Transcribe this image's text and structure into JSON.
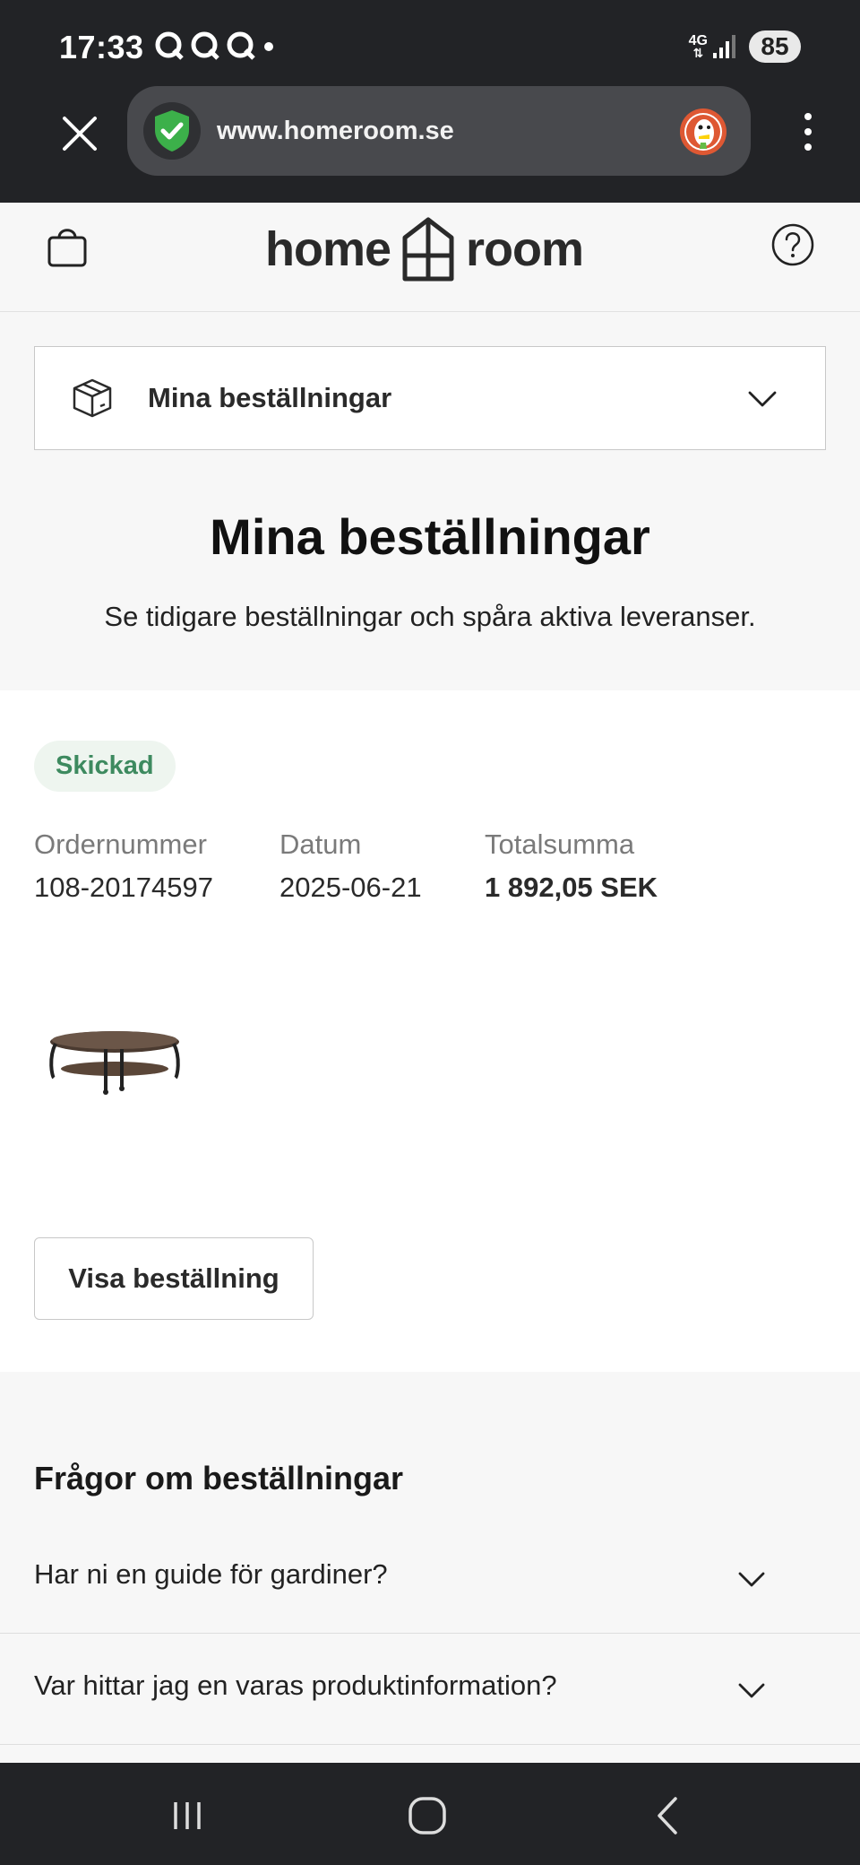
{
  "status_bar": {
    "time": "17:33",
    "network": "4G",
    "battery": "85"
  },
  "browser": {
    "url": "www.homeroom.se"
  },
  "header": {
    "logo_left": "home",
    "logo_right": "room"
  },
  "account_menu": {
    "selected": "Mina beställningar"
  },
  "page": {
    "title": "Mina beställningar",
    "subtitle": "Se tidigare beställningar och spåra aktiva leveranser."
  },
  "order": {
    "status": "Skickad",
    "order_number_label": "Ordernummer",
    "order_number": "108-20174597",
    "date_label": "Datum",
    "date": "2025-06-21",
    "total_label": "Totalsumma",
    "total": "1 892,05 SEK",
    "view_button": "Visa beställning"
  },
  "faq": {
    "title": "Frågor om beställningar",
    "items": [
      "Har ni en guide för gardiner?",
      "Var hittar jag en varas produktinformation?"
    ]
  },
  "colors": {
    "chrome_bg": "#222326",
    "badge_bg": "#eef5ef",
    "badge_text": "#3d8a5f",
    "shield_green": "#3cb04a",
    "ddg_orange": "#de5833"
  }
}
